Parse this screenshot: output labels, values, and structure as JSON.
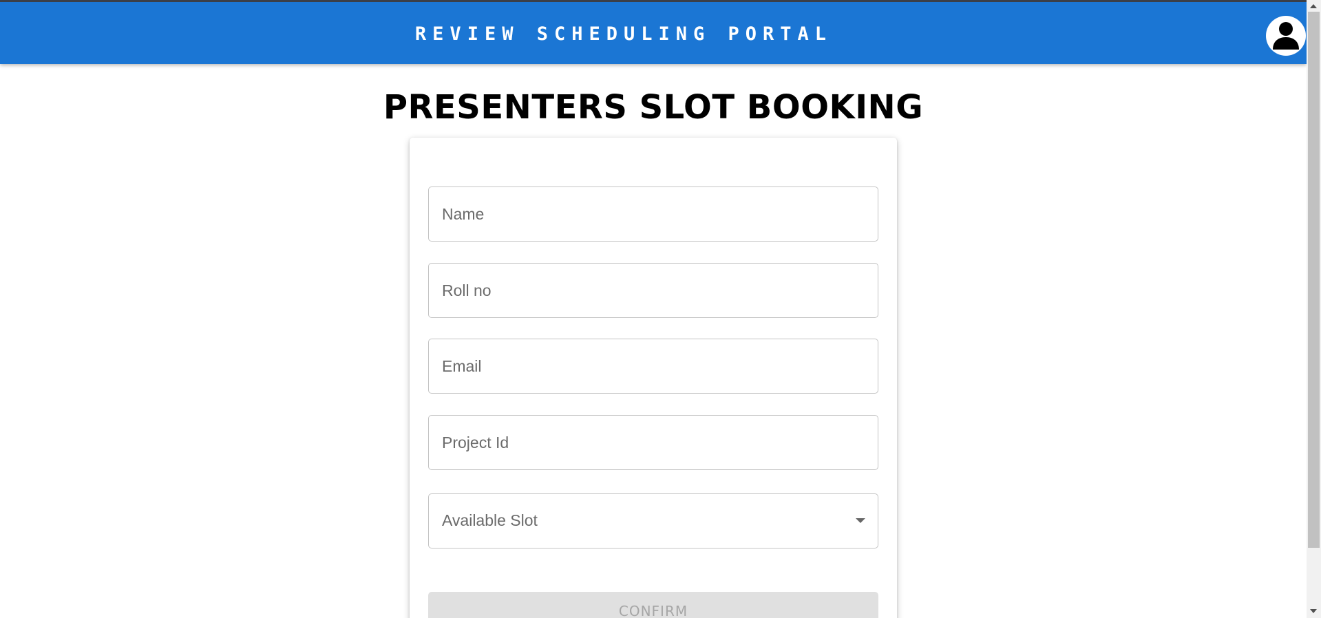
{
  "header": {
    "title": "REVIEW SCHEDULING PORTAL",
    "account_icon": "account-circle-icon",
    "color": "#1b76d4"
  },
  "page": {
    "title": "PRESENTERS SLOT BOOKING"
  },
  "form": {
    "name_placeholder": "Name",
    "rollno_placeholder": "Roll no",
    "email_placeholder": "Email",
    "projectid_placeholder": "Project Id",
    "slot_label": "Available Slot",
    "slot_icon": "arrow-drop-down-icon",
    "confirm_label": "CONFIRM",
    "confirm_state": "disabled"
  }
}
